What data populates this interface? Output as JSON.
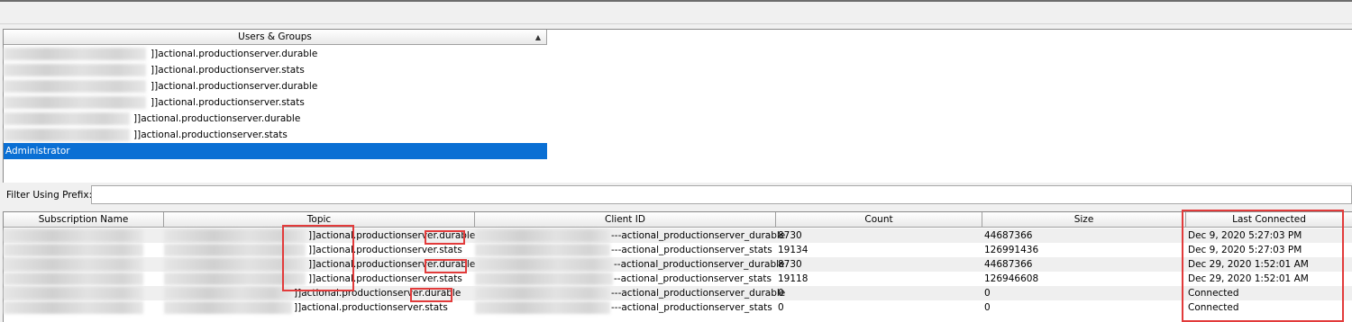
{
  "users_table": {
    "header": "Users & Groups",
    "rows": [
      {
        "text": "]]actional.productionserver.durable",
        "selected": false
      },
      {
        "text": "]]actional.productionserver.stats",
        "selected": false
      },
      {
        "text": "]]actional.productionserver.durable",
        "selected": false
      },
      {
        "text": "]]actional.productionserver.stats",
        "selected": false
      },
      {
        "text": "]]actional.productionserver.durable",
        "selected": false
      },
      {
        "text": "]]actional.productionserver.stats",
        "selected": false
      },
      {
        "text": "Administrator",
        "selected": true
      }
    ]
  },
  "filter": {
    "label": "Filter Using Prefix:",
    "value": ""
  },
  "subscriptions_table": {
    "columns": [
      "Subscription Name",
      "Topic",
      "Client ID",
      "Count",
      "Size",
      "Last Connected"
    ],
    "rows": [
      {
        "topic": "]]actional.productionserver.durable",
        "client_id": "---actional_productionserver_durable",
        "count": "8730",
        "size": "44687366",
        "last_connected": "Dec 9, 2020 5:27:03 PM"
      },
      {
        "topic": "]]actional.productionserver.stats",
        "client_id": "---actional_productionserver_stats",
        "count": "19134",
        "size": "126991436",
        "last_connected": "Dec 9, 2020 5:27:03 PM"
      },
      {
        "topic": "]]actional.productionserver.durable",
        "client_id": "--actional_productionserver_durable",
        "count": "8730",
        "size": "44687366",
        "last_connected": "Dec 29, 2020 1:52:01 AM"
      },
      {
        "topic": "]]actional.productionserver.stats",
        "client_id": "--actional_productionserver_stats",
        "count": "19118",
        "size": "126946608",
        "last_connected": "Dec 29, 2020 1:52:01 AM"
      },
      {
        "topic": "]]actional.productionserver.durable",
        "client_id": "---actional_productionserver_durable",
        "count": "0",
        "size": "0",
        "last_connected": "Connected"
      },
      {
        "topic": "]]actional.productionserver.stats",
        "client_id": "---actional_productionserver_stats",
        "count": "0",
        "size": "0",
        "last_connected": "Connected"
      }
    ]
  },
  "colors": {
    "selection": "#0a6fd4",
    "annotation": "#e23b3b"
  }
}
